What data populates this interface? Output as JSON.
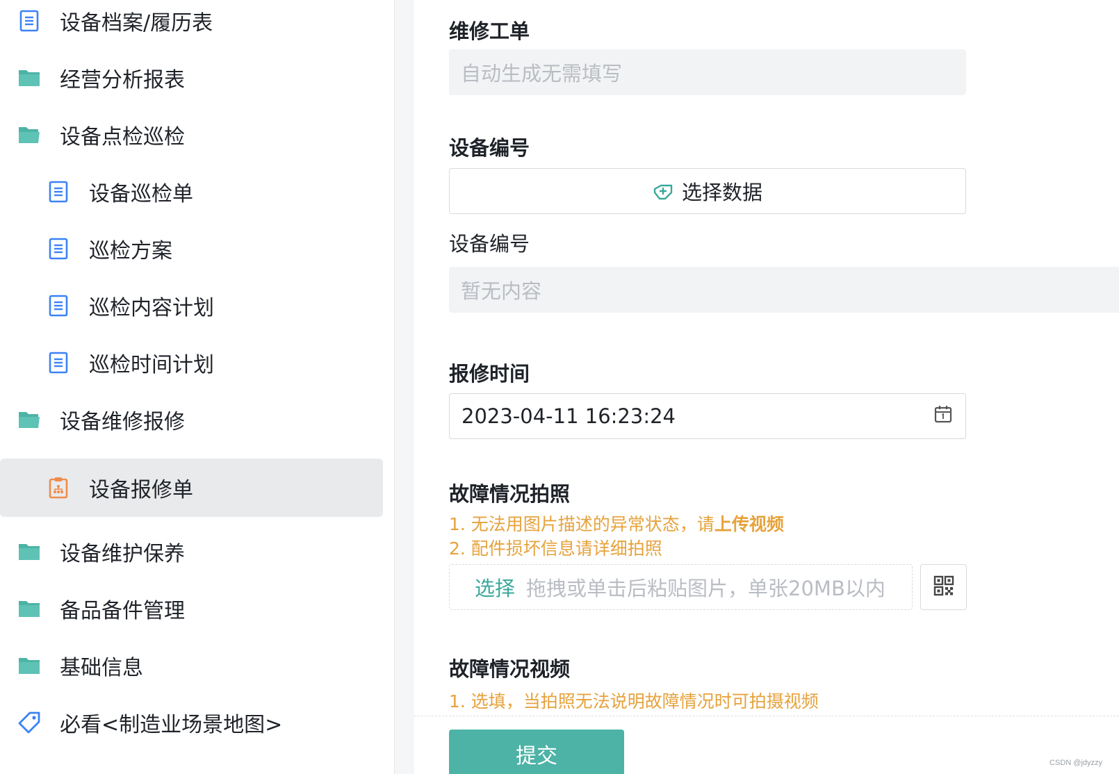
{
  "sidebar": {
    "items": [
      {
        "label": "设备档案/履历表",
        "icon": "document-icon"
      },
      {
        "label": "经营分析报表",
        "icon": "folder-icon"
      },
      {
        "label": "设备点检巡检",
        "icon": "folder-icon"
      },
      {
        "label": "设备巡检单",
        "icon": "document-icon"
      },
      {
        "label": "巡检方案",
        "icon": "document-icon"
      },
      {
        "label": "巡检内容计划",
        "icon": "document-icon"
      },
      {
        "label": "巡检时间计划",
        "icon": "document-icon"
      },
      {
        "label": "设备维修报修",
        "icon": "folder-icon"
      },
      {
        "label": "设备报修单",
        "icon": "clipboard-icon",
        "active": true
      },
      {
        "label": "设备维护保养",
        "icon": "folder-icon"
      },
      {
        "label": "备品备件管理",
        "icon": "folder-icon"
      },
      {
        "label": "基础信息",
        "icon": "folder-icon"
      },
      {
        "label": "必看<制造业场景地图>",
        "icon": "tag-icon"
      }
    ]
  },
  "form": {
    "work_order": {
      "label": "维修工单",
      "placeholder": "自动生成无需填写"
    },
    "device_no": {
      "label": "设备编号",
      "select_button": "选择数据"
    },
    "device_no_display": {
      "label": "设备编号",
      "placeholder": "暂无内容"
    },
    "report_time": {
      "label": "报修时间",
      "value": "2023-04-11 16:23:24"
    },
    "fault_photo": {
      "label": "故障情况拍照",
      "hint1_prefix": "1. 无法用图片描述的异常状态，请",
      "hint1_bold": "上传视频",
      "hint2": "2. 配件损坏信息请详细拍照",
      "upload_pick": "选择",
      "upload_hint": "拖拽或单击后粘贴图片，单张20MB以内"
    },
    "fault_video": {
      "label": "故障情况视频",
      "hint1": "1. 选填，当拍照无法说明故障情况时可拍摄视频"
    },
    "submit_label": "提交"
  },
  "watermark": "CSDN @jdyzzy",
  "colors": {
    "accent": "#4db3a6",
    "folder": "#4db3a6",
    "document": "#3b82f6",
    "active_icon": "#f08c4a",
    "hint": "#e6a23c",
    "readonly_bg": "#f2f3f5",
    "active_bg": "#e9eaec"
  }
}
